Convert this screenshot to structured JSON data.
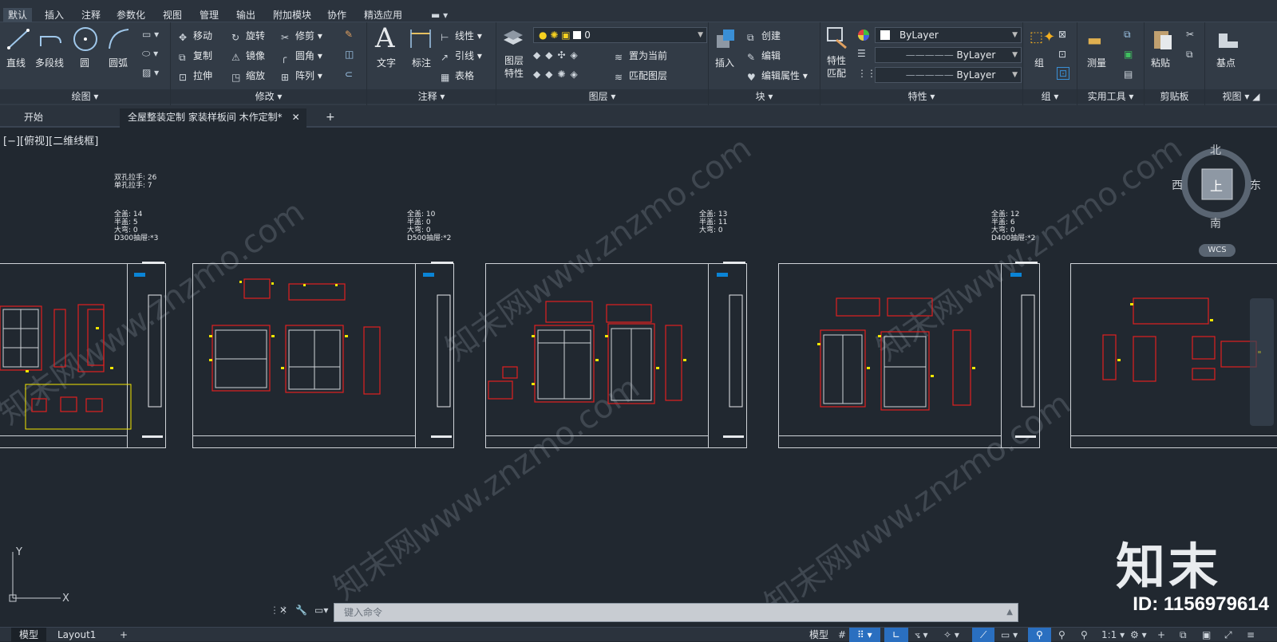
{
  "ribbon_tabs": [
    "默认",
    "插入",
    "注释",
    "参数化",
    "视图",
    "管理",
    "输出",
    "附加模块",
    "协作",
    "精选应用"
  ],
  "draw_panel": {
    "title": "绘图",
    "tools": [
      "直线",
      "多段线",
      "圆",
      "圆弧"
    ]
  },
  "modify_panel": {
    "title": "修改",
    "tools": [
      "移动",
      "旋转",
      "修剪",
      "复制",
      "镜像",
      "圆角",
      "拉伸",
      "缩放",
      "阵列"
    ]
  },
  "annotation_panel": {
    "title": "注释",
    "tools": [
      "文字",
      "标注",
      "线性",
      "引线",
      "表格"
    ]
  },
  "layers_panel": {
    "title": "图层",
    "layer_value": "0",
    "props_label": "图层\n特性",
    "tools": [
      "置为当前",
      "匹配图层"
    ]
  },
  "block_panel": {
    "title": "块",
    "insert_label": "插入",
    "tools": [
      "创建",
      "编辑",
      "编辑属性"
    ]
  },
  "properties_panel": {
    "title": "特性",
    "match_label": "特性\n匹配",
    "values": [
      "ByLayer",
      "ByLayer",
      "ByLayer"
    ]
  },
  "group_panel": {
    "title": "组",
    "label": "组"
  },
  "utility_panel": {
    "title": "实用工具",
    "label": "测量"
  },
  "clipboard_panel": {
    "title": "剪贴板",
    "label": "粘贴"
  },
  "view_panel": {
    "title": "视图",
    "label": "基点"
  },
  "doc_tabs": [
    "开始",
    "全屋整装定制 家装样板间 木作定制*"
  ],
  "view_label": "[−][俯视][二维线框]",
  "compass": {
    "n": "北",
    "s": "南",
    "e": "东",
    "w": "西",
    "center": "上",
    "wcs": "WCS"
  },
  "handles": "双孔拉手: 26\n单孔拉手: 7",
  "sheet_stats": [
    "全盖: 14\n半盖: 5\n大弯: 0\nD300抽屉:*3",
    "全盖: 10\n半盖: 0\n大弯: 0\nD500抽屉:*2",
    "全盖: 13\n半盖: 11\n大弯: 0",
    "全盖: 12\n半盖: 6\n大弯: 0\nD400抽屉:*2"
  ],
  "command_placeholder": "键入命令",
  "layout_tabs": [
    "模型",
    "Layout1"
  ],
  "status_model": "模型",
  "scale": "1:1",
  "watermark_logo": "知末",
  "watermark_id": "ID: 1156979614",
  "watermark_text": "知末网www.znzmo.com",
  "colors": {
    "accent_blue": "#0a84d6",
    "cad_red": "#e02020",
    "cad_yellow": "#f2e600",
    "bg": "#212830"
  }
}
